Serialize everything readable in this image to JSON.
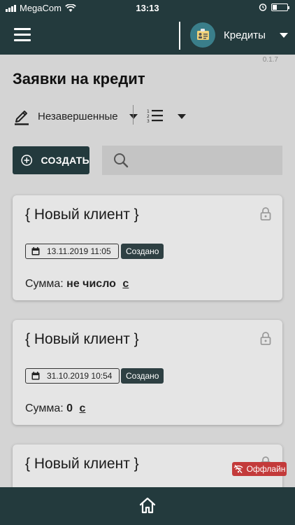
{
  "status_bar": {
    "carrier": "MegaCom",
    "time": "13:13",
    "battery_level": 0.3
  },
  "header": {
    "account_name": "Кредиты"
  },
  "version": "0.1.7",
  "page": {
    "title": "Заявки на кредит"
  },
  "toolbar": {
    "filter_label": "Незавершенные",
    "create_label": "СОЗДАТЬ",
    "search_placeholder": ""
  },
  "cards": [
    {
      "title": "{ Новый клиент }",
      "date": "13.11.2019 11:05",
      "status": "Создано",
      "sum_label": "Сумма:",
      "sum_value": "не число",
      "currency": "с"
    },
    {
      "title": "{ Новый клиент }",
      "date": "31.10.2019 10:54",
      "status": "Создано",
      "sum_label": "Сумма:",
      "sum_value": "0",
      "currency": "с"
    },
    {
      "title": "{ Новый клиент }"
    }
  ],
  "offline_label": "Оффлайн",
  "icons": {
    "menu": "hamburger-icon",
    "account": "id-card-icon",
    "filter": "pencil-icon",
    "sort": "numbered-list-icon",
    "create": "plus-circle-icon",
    "search": "search-icon",
    "lock": "lock-icon",
    "calendar": "calendar-icon",
    "offline": "wifi-off-icon",
    "home": "home-icon"
  },
  "colors": {
    "primary": "#233a3d",
    "badge": "#2e4043",
    "offline": "#c33a3a",
    "avatar": "#3a7e8a"
  }
}
